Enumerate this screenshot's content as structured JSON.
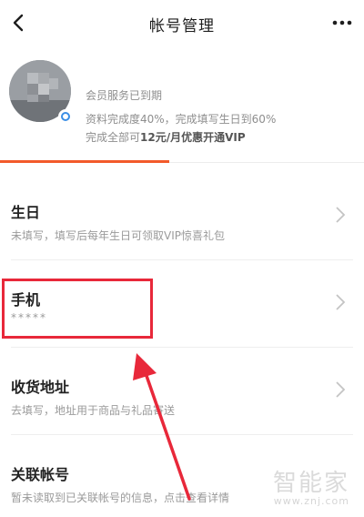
{
  "header": {
    "title": "帐号管理",
    "back_icon": "chevron-left-icon",
    "more_icon": "more-dots-icon"
  },
  "profile": {
    "membership_status": "会员服务已到期",
    "completion_text": "资料完成度40%，完成填写生日到60%",
    "offer_prefix": "完成全部可",
    "offer_highlight": "12元/月优惠开通VIP"
  },
  "rows": [
    {
      "title": "生日",
      "subtitle": "未填写，填写后每年生日可领取VIP惊喜礼包"
    },
    {
      "title": "手机",
      "subtitle": "*****"
    },
    {
      "title": "收货地址",
      "subtitle": "去填写，地址用于商品与礼品寄送"
    },
    {
      "title": "关联帐号",
      "subtitle": "暂未读取到已关联帐号的信息，点击查看详情"
    }
  ],
  "watermark": {
    "text": "智能家",
    "url": "www.znj.com"
  },
  "colors": {
    "accent": "#f25a2a",
    "annotation_red": "#e8283a",
    "vip_ring": "#3a8ee6"
  }
}
